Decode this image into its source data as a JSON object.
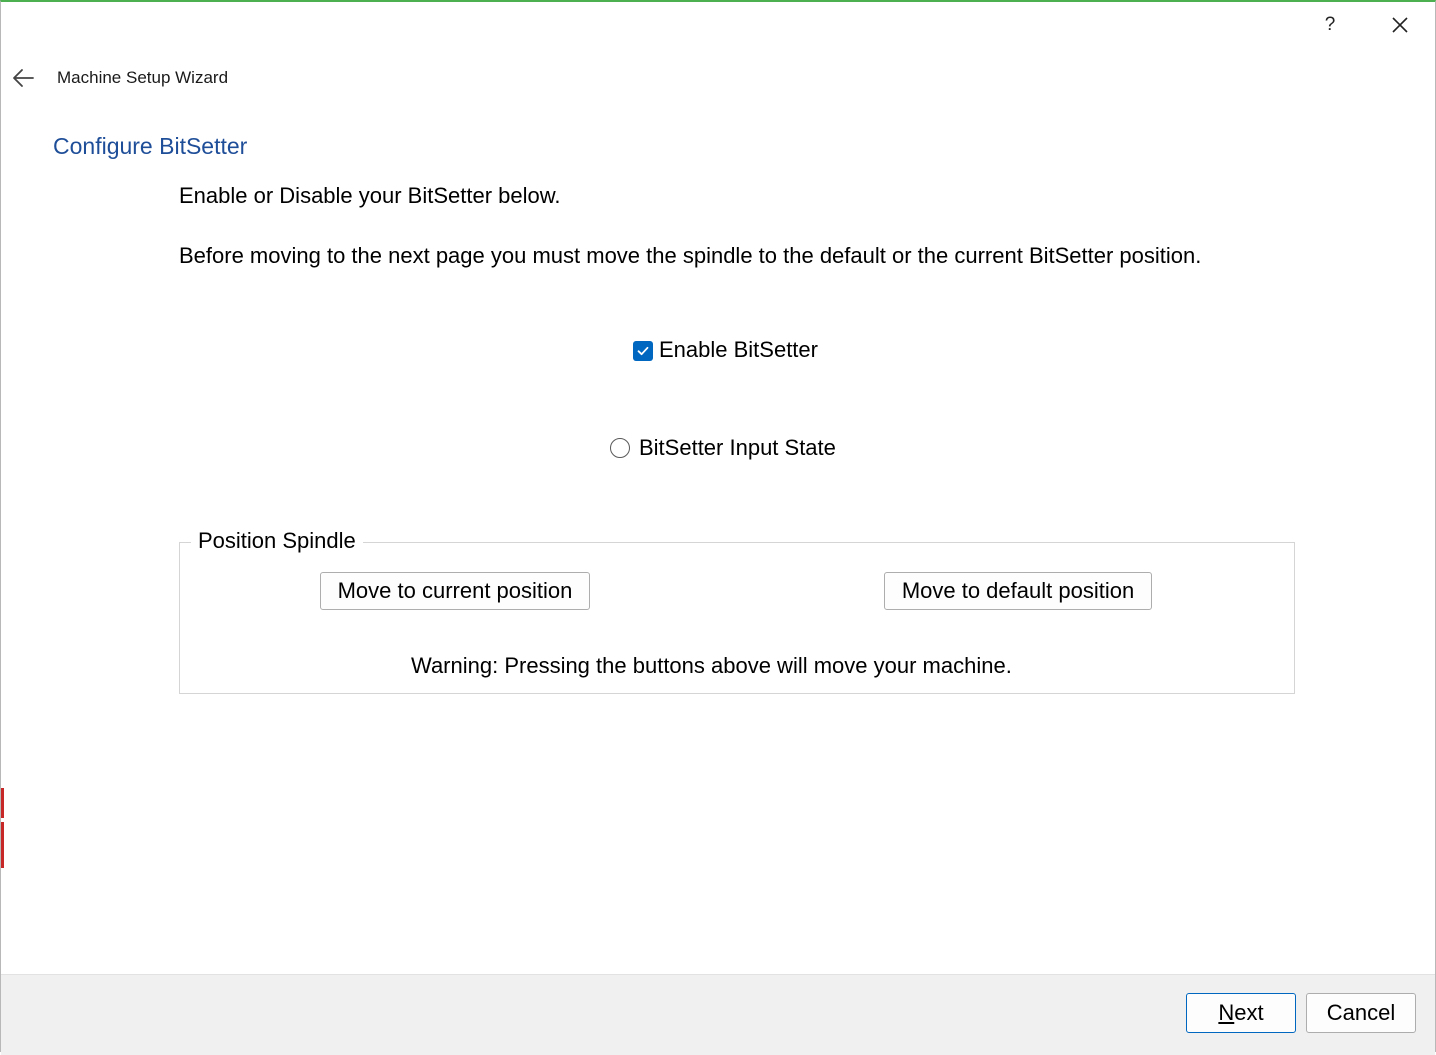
{
  "window": {
    "help_label": "?",
    "close_icon": "close-icon",
    "back_icon": "arrow-left-icon",
    "accent_color": "#4caf50"
  },
  "wizard": {
    "title": "Machine Setup Wizard"
  },
  "page": {
    "title": "Configure BitSetter",
    "instruction_1": "Enable or Disable your BitSetter below.",
    "instruction_2": "Before moving to the next page you must move the spindle to the default or the current BitSetter position."
  },
  "options": {
    "enable_bitsetter": {
      "label": "Enable BitSetter",
      "checked": true
    },
    "input_state": {
      "label": "BitSetter Input State",
      "active": false
    }
  },
  "position_spindle": {
    "legend": "Position Spindle",
    "move_current_label": "Move to current position",
    "move_default_label": "Move to default position",
    "warning": "Warning: Pressing the buttons above will move your machine."
  },
  "footer": {
    "next_mnemonic": "N",
    "next_rest": "ext",
    "cancel_label": "Cancel"
  },
  "colors": {
    "heading": "#1f4e99",
    "checkbox": "#0067c0",
    "footer_bg": "#f0f0f0"
  }
}
